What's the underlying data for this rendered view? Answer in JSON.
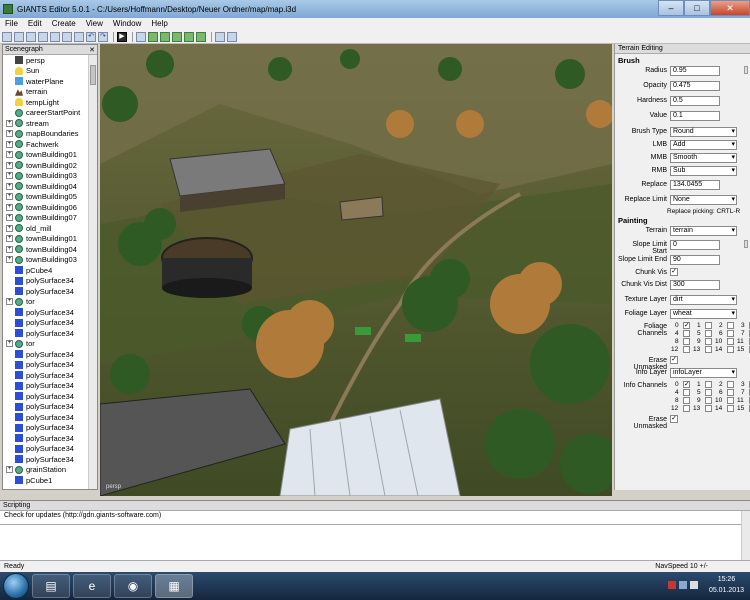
{
  "window": {
    "title": "GIANTS Editor 5.0.1 - C:/Users/Hoffmann/Desktop/Neuer Ordner/map/map.i3d",
    "minimize": "–",
    "maximize": "□",
    "close": "✕"
  },
  "menu": [
    "File",
    "Edit",
    "Create",
    "View",
    "Window",
    "Help"
  ],
  "scenegraph": {
    "title": "Scenegraph",
    "items": [
      {
        "label": "persp",
        "icon": "camera-icon",
        "expand": false
      },
      {
        "label": "Sun",
        "icon": "light-icon",
        "expand": false
      },
      {
        "label": "waterPlane",
        "icon": "water-icon",
        "expand": false
      },
      {
        "label": "terrain",
        "icon": "terrain-icon",
        "expand": false
      },
      {
        "label": "tempLight",
        "icon": "light-icon",
        "expand": false
      },
      {
        "label": "careerStartPoint",
        "icon": "node-icon",
        "expand": false
      },
      {
        "label": "stream",
        "icon": "node-icon",
        "expand": true
      },
      {
        "label": "mapBoundaries",
        "icon": "node-icon",
        "expand": true
      },
      {
        "label": "Fachwerk",
        "icon": "node-icon",
        "expand": true
      },
      {
        "label": "townBuilding01",
        "icon": "node-icon",
        "expand": true
      },
      {
        "label": "townBuilding02",
        "icon": "node-icon",
        "expand": true
      },
      {
        "label": "townBuilding03",
        "icon": "node-icon",
        "expand": true
      },
      {
        "label": "townBuilding04",
        "icon": "node-icon",
        "expand": true
      },
      {
        "label": "townBuilding05",
        "icon": "node-icon",
        "expand": true
      },
      {
        "label": "townBuilding06",
        "icon": "node-icon",
        "expand": true
      },
      {
        "label": "townBuilding07",
        "icon": "node-icon",
        "expand": true
      },
      {
        "label": "old_mill",
        "icon": "node-icon",
        "expand": true
      },
      {
        "label": "townBuilding01",
        "icon": "node-icon",
        "expand": true
      },
      {
        "label": "townBuilding04",
        "icon": "node-icon",
        "expand": true
      },
      {
        "label": "townBuilding03",
        "icon": "node-icon",
        "expand": true
      },
      {
        "label": "pCube4",
        "icon": "cube-icon",
        "expand": false
      },
      {
        "label": "polySurface34",
        "icon": "cube-icon",
        "expand": false
      },
      {
        "label": "polySurface34",
        "icon": "cube-icon",
        "expand": false
      },
      {
        "label": "tor",
        "icon": "node-icon",
        "expand": true
      },
      {
        "label": "polySurface34",
        "icon": "cube-icon",
        "expand": false
      },
      {
        "label": "polySurface34",
        "icon": "cube-icon",
        "expand": false
      },
      {
        "label": "polySurface34",
        "icon": "cube-icon",
        "expand": false
      },
      {
        "label": "tor",
        "icon": "node-icon",
        "expand": true
      },
      {
        "label": "polySurface34",
        "icon": "cube-icon",
        "expand": false
      },
      {
        "label": "polySurface34",
        "icon": "cube-icon",
        "expand": false
      },
      {
        "label": "polySurface34",
        "icon": "cube-icon",
        "expand": false
      },
      {
        "label": "polySurface34",
        "icon": "cube-icon",
        "expand": false
      },
      {
        "label": "polySurface34",
        "icon": "cube-icon",
        "expand": false
      },
      {
        "label": "polySurface34",
        "icon": "cube-icon",
        "expand": false
      },
      {
        "label": "polySurface34",
        "icon": "cube-icon",
        "expand": false
      },
      {
        "label": "polySurface34",
        "icon": "cube-icon",
        "expand": false
      },
      {
        "label": "polySurface34",
        "icon": "cube-icon",
        "expand": false
      },
      {
        "label": "polySurface34",
        "icon": "cube-icon",
        "expand": false
      },
      {
        "label": "polySurface34",
        "icon": "cube-icon",
        "expand": false
      },
      {
        "label": "grainStation",
        "icon": "node-icon",
        "expand": true
      },
      {
        "label": "pCube1",
        "icon": "cube-icon",
        "expand": false
      }
    ]
  },
  "viewport": {
    "camera_label": "persp"
  },
  "terrain_editing": {
    "title": "Terrain Editing",
    "brush": {
      "section": "Brush",
      "radius_label": "Radius",
      "radius": "0.95",
      "opacity_label": "Opacity",
      "opacity": "0.475",
      "hardness_label": "Hardness",
      "hardness": "0.5",
      "value_label": "Value",
      "value": "0.1",
      "brush_type_label": "Brush Type",
      "brush_type": "Round",
      "lmb_label": "LMB",
      "lmb": "Add",
      "mmb_label": "MMB",
      "mmb": "Smooth",
      "rmb_label": "RMB",
      "rmb": "Sub",
      "replace_label": "Replace",
      "replace": "134.0455",
      "replace_limit_label": "Replace Limit",
      "replace_limit": "None",
      "replace_note": "Replace picking: CRTL-R"
    },
    "painting": {
      "section": "Painting",
      "terrain_label": "Terrain",
      "terrain": "terrain",
      "slope_start_label": "Slope Limit Start",
      "slope_start": "0",
      "slope_end_label": "Slope Limit End",
      "slope_end": "90",
      "chunk_vis_label": "Chunk Vis",
      "chunk_vis_dist_label": "Chunk Vis Dist",
      "chunk_vis_dist": "300",
      "texture_layer_label": "Texture Layer",
      "texture_layer": "dirt",
      "foliage_layer_label": "Foliage Layer",
      "foliage_layer": "wheat",
      "foliage_channels_label": "Foliage Channels",
      "erase_unmasked_label": "Erase Unmasked",
      "info_layer_label": "Info Layer",
      "info_layer": "infoLayer",
      "info_channels_label": "Info Channels",
      "erase_unmasked2_label": "Erase Unmasked"
    },
    "channel_numbers": [
      "0",
      "1",
      "2",
      "3",
      "4",
      "5",
      "6",
      "7",
      "8",
      "9",
      "10",
      "11",
      "12",
      "13",
      "14",
      "15"
    ]
  },
  "scripting": {
    "title": "Scripting",
    "output": "Check for updates (http://gdn.giants-software.com)"
  },
  "status": {
    "left": "Ready",
    "right": "NavSpeed 10 +/-"
  },
  "taskbar": {
    "time": "15:26",
    "date": "05.01.2013"
  }
}
